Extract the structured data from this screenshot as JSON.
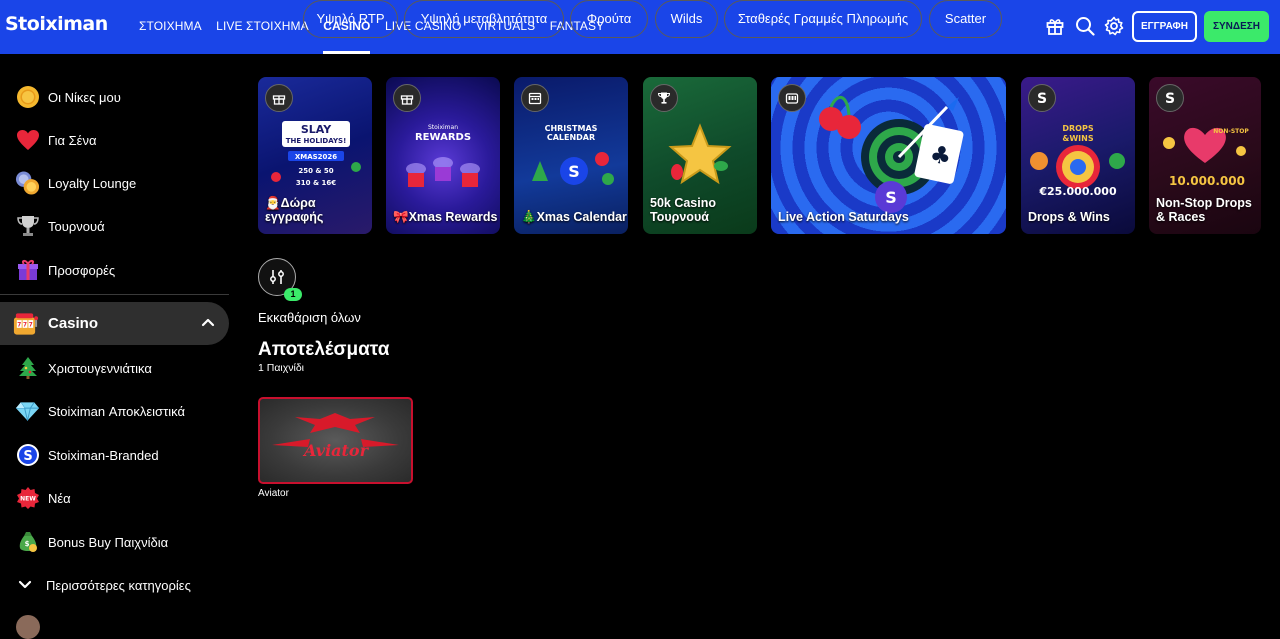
{
  "brand": {
    "logo_text": "Stoiximan",
    "top_bar_color": "#1a45e8",
    "accent_green": "#3bea6a"
  },
  "nav": {
    "items": [
      {
        "label": "ΣΤΟΙΧΗΜΑ",
        "active": false
      },
      {
        "label": "LIVE ΣΤΟΙΧΗΜΑ",
        "active": false
      },
      {
        "label": "CASINO",
        "active": true
      },
      {
        "label": "LIVE CASINO",
        "active": false
      },
      {
        "label": "VIRTUALS",
        "active": false
      },
      {
        "label": "FANTASY",
        "active": false
      }
    ],
    "icons": [
      "gift-icon",
      "search-icon",
      "gear-icon"
    ],
    "register_label": "ΕΓΓΡΑΦΗ",
    "login_label": "ΣΥΝΔΕΣΗ"
  },
  "sidebar": {
    "items": [
      {
        "label": "Οι Νίκες μου",
        "icon": "coin-icon"
      },
      {
        "label": "Για Σένα",
        "icon": "heart-icon"
      },
      {
        "label": "Loyalty Lounge",
        "icon": "loyalty-coins-icon"
      },
      {
        "label": "Τουρνουά",
        "icon": "trophy-icon"
      },
      {
        "label": "Προσφορές",
        "icon": "gift-box-icon"
      }
    ],
    "casino": {
      "label": "Casino",
      "icon": "slot-machine-icon"
    },
    "sub_items": [
      {
        "label": "Χριστουγεννιάτικα",
        "icon": "christmas-tree-icon"
      },
      {
        "label": "Stoiximan Αποκλειστικά",
        "icon": "diamond-icon"
      },
      {
        "label": "Stoiximan-Branded",
        "icon": "stoiximan-logo-icon"
      },
      {
        "label": "Νέα",
        "icon": "new-badge-icon"
      },
      {
        "label": "Bonus Buy Παιχνίδια",
        "icon": "money-bag-icon"
      }
    ],
    "more_label": "Περισσότερες κατηγορίες"
  },
  "promos": [
    {
      "title": "Δώρα εγγραφής",
      "emoji": "🎅",
      "icon": "gift-icon",
      "card_text": "SLAY THE HOLIDAYS! XMAS2026"
    },
    {
      "title": "Xmas Rewards",
      "emoji": "🎀",
      "icon": "gift-icon",
      "card_text": "Stoiximan REWARDS"
    },
    {
      "title": "Xmas Calendar",
      "emoji": "🎄",
      "icon": "calendar-icon",
      "card_text": "CHRISTMAS CALENDAR"
    },
    {
      "title": "50k Casino Τουρνουά",
      "emoji": "",
      "icon": "trophy-icon",
      "card_text": ""
    },
    {
      "title": "Live Action Saturdays",
      "emoji": "",
      "icon": "slot-icon",
      "card_text": ""
    },
    {
      "title": "Drops & Wins",
      "emoji": "",
      "icon": "stoiximan-icon",
      "card_text": "DROPS & WINS €25.000.000"
    },
    {
      "title": "Non-Stop Drops & Races",
      "emoji": "",
      "icon": "stoiximan-icon",
      "card_text": "NON-STOP 10.000.000"
    }
  ],
  "filters": {
    "active_count": "1",
    "chips": [
      "Υψηλό RTP",
      "Υψηλή μεταβλητότητα",
      "Φρούτα",
      "Wilds",
      "Σταθερές Γραμμές Πληρωμής",
      "Scatter"
    ],
    "clear_label": "Εκκαθάριση όλων"
  },
  "results": {
    "title": "Αποτελέσματα",
    "count_label": "1 Παιχνίδι",
    "games": [
      {
        "name": "Aviator",
        "logo_text": "Aviator"
      }
    ]
  }
}
